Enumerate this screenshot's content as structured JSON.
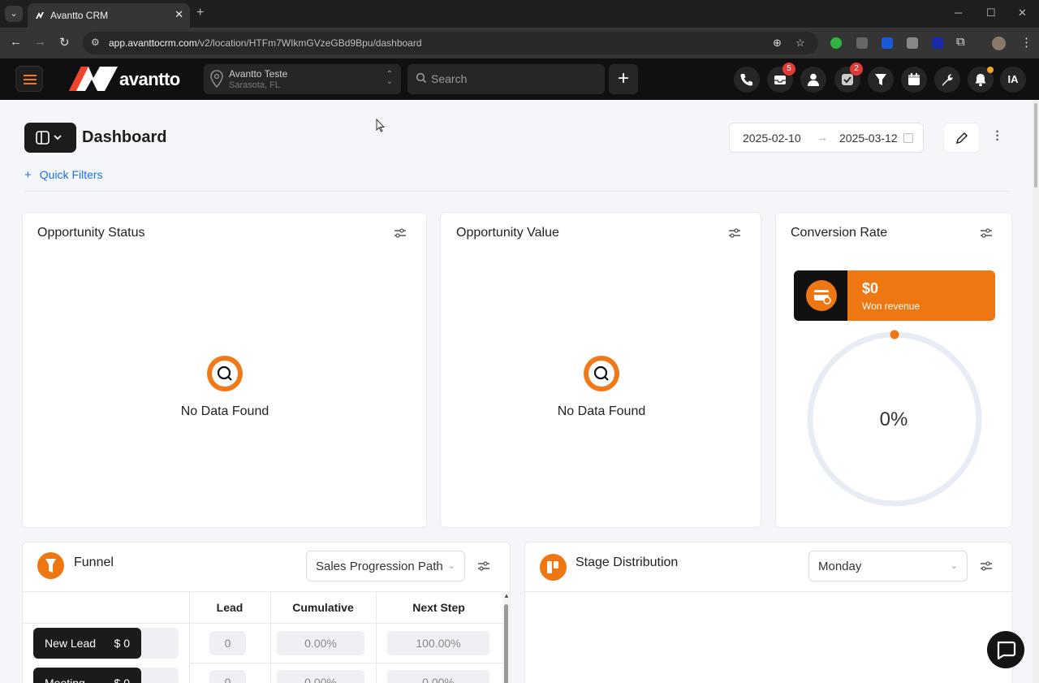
{
  "browser": {
    "tab_title": "Avantto CRM",
    "tab_close": "✕",
    "new_tab": "+",
    "url_host": "app.avanttocrm.com",
    "url_path": "/v2/location/HTFm7WIkmGVzeGBd9Bpu/dashboard"
  },
  "header": {
    "logo_text": "avantto",
    "location_name": "Avantto Teste",
    "location_sub": "Sarasota, FL",
    "search_placeholder": "Search",
    "add_label": "+",
    "messages_badge": "5",
    "tasks_badge": "2",
    "avatar_initials": "IA"
  },
  "page": {
    "title": "Dashboard",
    "date_start": "2025-02-10",
    "date_arrow": "→",
    "date_end": "2025-03-12",
    "quick_filters_icon": "+",
    "quick_filters": "Quick Filters"
  },
  "cards": {
    "opportunity_status": {
      "title": "Opportunity Status",
      "empty": "No Data Found"
    },
    "opportunity_value": {
      "title": "Opportunity Value",
      "empty": "No Data Found"
    },
    "conversion_rate": {
      "title": "Conversion Rate",
      "won_value": "$0",
      "won_label": "Won revenue",
      "percent": "0%"
    },
    "funnel": {
      "title": "Funnel",
      "select": "Sales Progression Path",
      "columns": [
        "Lead",
        "Cumulative",
        "Next Step"
      ],
      "rows": [
        {
          "stage": "New Lead",
          "value": "$ 0",
          "lead": "0",
          "cumulative": "0.00%",
          "next": "100.00%"
        },
        {
          "stage": "Meeting",
          "value": "$ 0",
          "lead": "0",
          "cumulative": "0.00%",
          "next": "0.00%"
        }
      ]
    },
    "stage_distribution": {
      "title": "Stage Distribution",
      "select": "Monday"
    }
  },
  "colors": {
    "accent": "#ee7711",
    "link": "#1f6fe0",
    "dark": "#101010"
  }
}
